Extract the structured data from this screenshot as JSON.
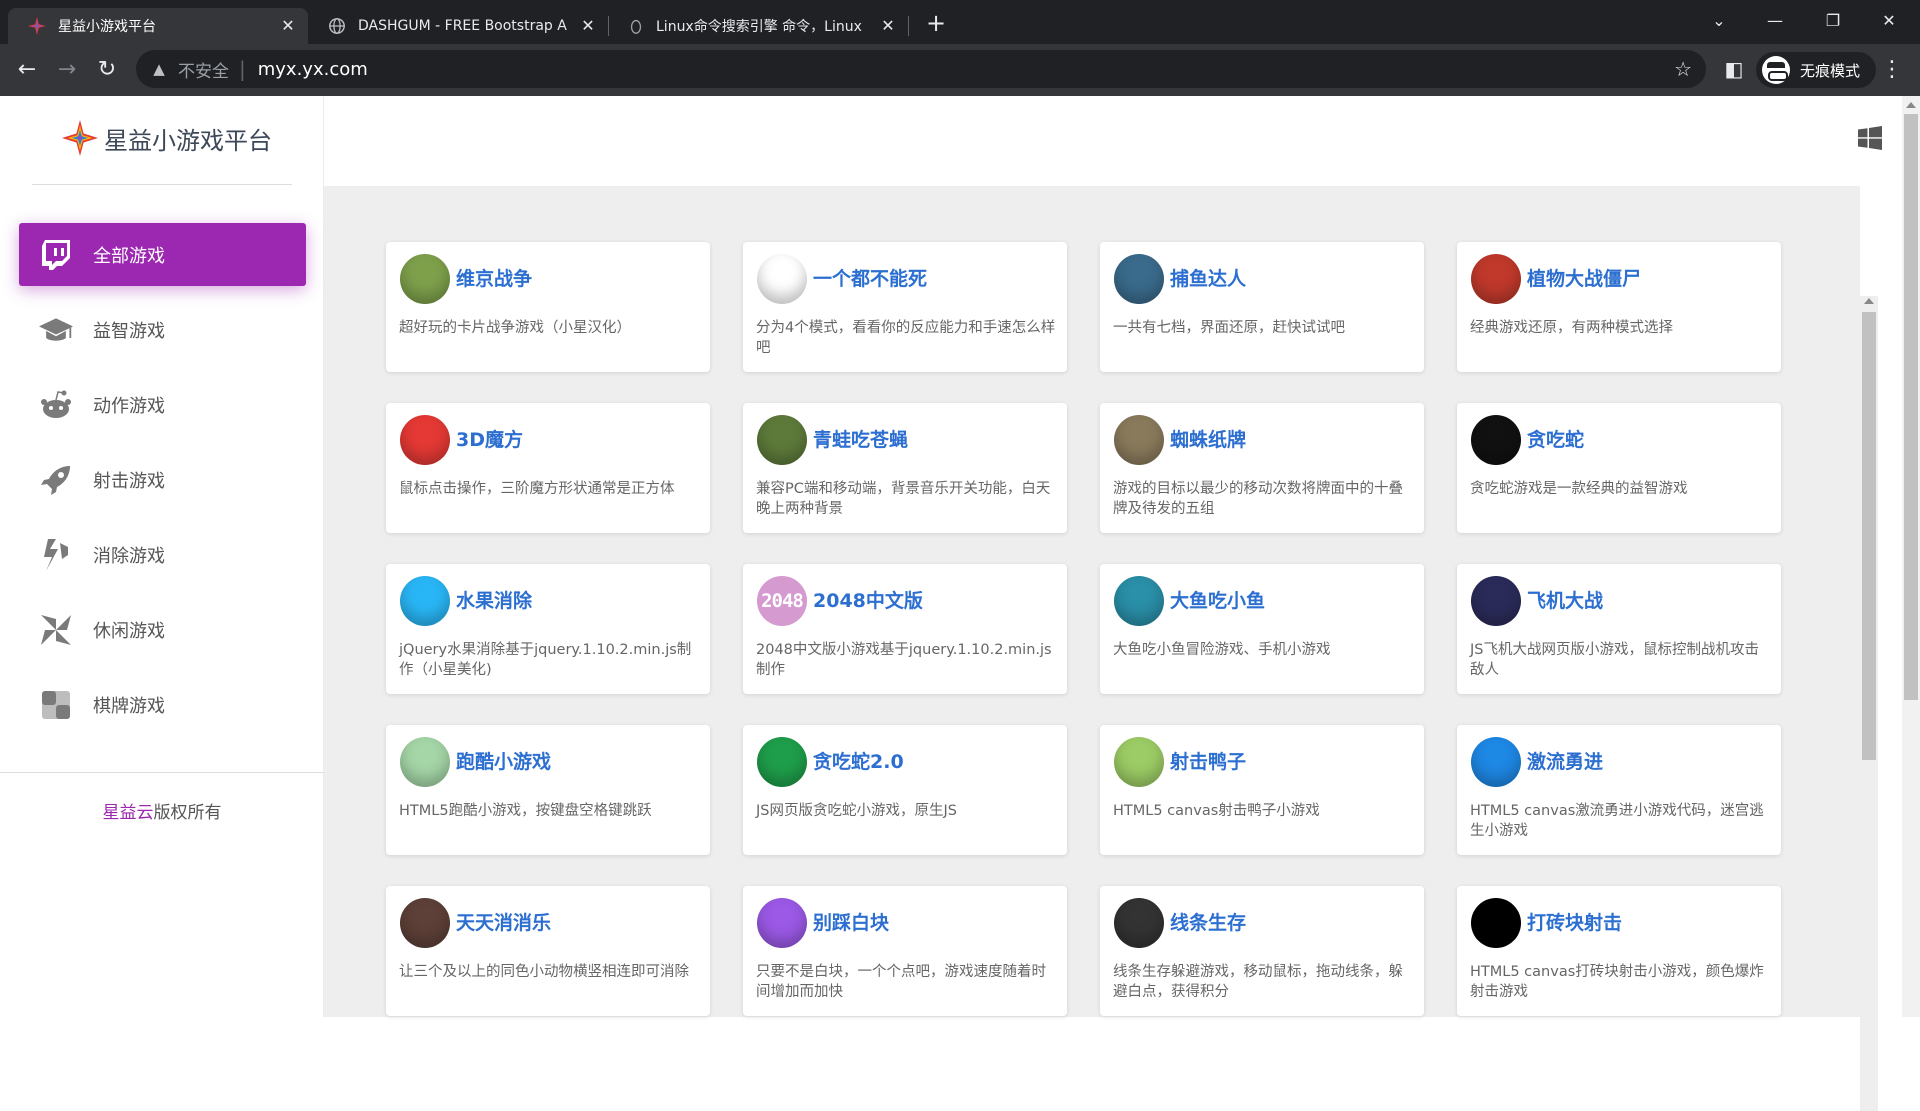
{
  "browser": {
    "tabs": [
      {
        "title": "星益小游戏平台",
        "close": "✕",
        "active": true
      },
      {
        "title": "DASHGUM - FREE Bootstrap A",
        "close": "✕",
        "active": false
      },
      {
        "title": "Linux命令搜索引擎 命令，Linux",
        "close": "✕",
        "active": false
      }
    ],
    "new_tab": "+",
    "window_controls": {
      "dropdown": "⌄",
      "minimize": "—",
      "restore": "❐",
      "close": "✕"
    },
    "nav": {
      "back": "←",
      "forward": "→",
      "reload": "↻"
    },
    "address": {
      "warning_icon": "▲",
      "insecure_label": "不安全",
      "separator": "|",
      "url": "myx.yx.com",
      "star": "☆"
    },
    "sidepanel_icon": "◧",
    "incognito_label": "无痕模式",
    "menu": "⋮"
  },
  "sidebar": {
    "brand": "星益小游戏平台",
    "items": [
      {
        "label": "全部游戏",
        "icon": "twitch-icon",
        "active": true
      },
      {
        "label": "益智游戏",
        "icon": "graduation-cap-icon",
        "active": false
      },
      {
        "label": "动作游戏",
        "icon": "reddit-icon",
        "active": false
      },
      {
        "label": "射击游戏",
        "icon": "rocket-icon",
        "active": false
      },
      {
        "label": "消除游戏",
        "icon": "hubspot-icon",
        "active": false
      },
      {
        "label": "休闲游戏",
        "icon": "pinwheel-icon",
        "active": false
      },
      {
        "label": "棋牌游戏",
        "icon": "checkerboard-icon",
        "active": false
      }
    ],
    "footer_brand": "星益云",
    "footer_rest": "版权所有"
  },
  "topbar": {
    "icon": "windows-icon"
  },
  "games": [
    {
      "title": "维京战争",
      "desc": "超好玩的卡片战争游戏（小星汉化）",
      "icon": "viking-icon",
      "color": "#7ea04b"
    },
    {
      "title": "一个都不能死",
      "desc": "分为4个模式，看看你的反应能力和手速怎么样吧",
      "icon": "running-man-icon",
      "color": "#ffffff"
    },
    {
      "title": "捕鱼达人",
      "desc": "一共有七档，界面还原，赶快试试吧",
      "icon": "fish-icon",
      "color": "#3a6b8c"
    },
    {
      "title": "植物大战僵尸",
      "desc": "经典游戏还原，有两种模式选择",
      "icon": "popcap-icon",
      "color": "#c0392b"
    },
    {
      "title": "3D魔方",
      "desc": "鼠标点击操作，三阶魔方形状通常是正方体",
      "icon": "rubiks-cube-icon",
      "color": "#e53935"
    },
    {
      "title": "青蛙吃苍蝇",
      "desc": "兼容PC端和移动端，背景音乐开关功能，白天晚上两种背景",
      "icon": "frog-icon",
      "color": "#5d7a3a"
    },
    {
      "title": "蜘蛛纸牌",
      "desc": "游戏的目标以最少的移动次数将牌面中的十叠牌及待发的五组",
      "icon": "playing-card-icon",
      "color": "#8a7a5c"
    },
    {
      "title": "贪吃蛇",
      "desc": "贪吃蛇游戏是一款经典的益智游戏",
      "icon": "snake-icon",
      "color": "#111111"
    },
    {
      "title": "水果消除",
      "desc": "jQuery水果消除基于jquery.1.10.2.min.js制作（小星美化)",
      "icon": "popsicle-icon",
      "color": "#29b6f6"
    },
    {
      "title": "2048中文版",
      "desc": "2048中文版小游戏基于jquery.1.10.2.min.js制作",
      "icon": "2048-icon",
      "color": "#d59ad0",
      "badge": "2048"
    },
    {
      "title": "大鱼吃小鱼",
      "desc": "大鱼吃小鱼冒险游戏、手机小游戏",
      "icon": "shark-icon",
      "color": "#2a8fa8"
    },
    {
      "title": "飞机大战",
      "desc": "JS飞机大战网页版小游戏，鼠标控制战机攻击敌人",
      "icon": "fighter-jet-icon",
      "color": "#2b2b5a"
    },
    {
      "title": "跑酷小游戏",
      "desc": "HTML5跑酷小游戏，按键盘空格键跳跃",
      "icon": "parkour-icon",
      "color": "#a5d6a7"
    },
    {
      "title": "贪吃蛇2.0",
      "desc": "JS网页版贪吃蛇小游戏，原生JS",
      "icon": "dots-snake-icon",
      "color": "#1e9e4a"
    },
    {
      "title": "射击鸭子",
      "desc": "HTML5 canvas射击鸭子小游戏",
      "icon": "duck-icon",
      "color": "#9ccc65"
    },
    {
      "title": "激流勇进",
      "desc": "HTML5 canvas激流勇进小游戏代码，迷宫逃生小游戏",
      "icon": "stairs-icon",
      "color": "#1e88e5"
    },
    {
      "title": "天天消消乐",
      "desc": "让三个及以上的同色小动物横竖相连即可消除",
      "icon": "animals-match-icon",
      "color": "#5d4037"
    },
    {
      "title": "别踩白块",
      "desc": "只要不是白块，一个个点吧，游戏速度随着时间增加而加快",
      "icon": "piano-tiles-icon",
      "color": "#9b59e6"
    },
    {
      "title": "线条生存",
      "desc": "线条生存躲避游戏，移动鼠标，拖动线条，躲避白点，获得积分",
      "icon": "line-survival-icon",
      "color": "#333333"
    },
    {
      "title": "打砖块射击",
      "desc": "HTML5 canvas打砖块射击小游戏，颜色爆炸射击游戏",
      "icon": "brick-shooter-icon",
      "color": "#000000"
    }
  ]
}
